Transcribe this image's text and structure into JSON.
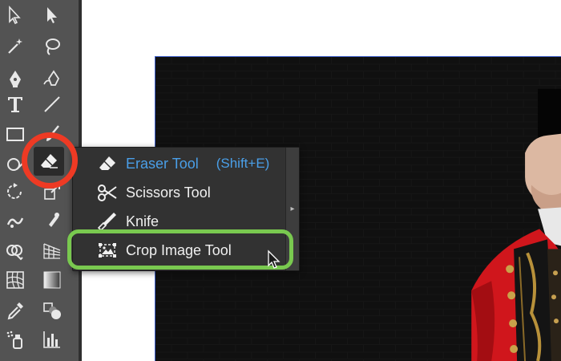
{
  "toolbar": {
    "tools": [
      {
        "name": "direct-selection-tool-icon"
      },
      {
        "name": "selection-tool-icon"
      },
      {
        "name": "magic-wand-tool-icon"
      },
      {
        "name": "lasso-tool-icon"
      },
      {
        "name": "pen-tool-icon"
      },
      {
        "name": "curvature-tool-icon"
      },
      {
        "name": "type-tool-icon",
        "glyph": "T"
      },
      {
        "name": "line-segment-tool-icon"
      },
      {
        "name": "rectangle-tool-icon"
      },
      {
        "name": "paintbrush-tool-icon"
      },
      {
        "name": "shaper-tool-icon"
      },
      {
        "name": "eraser-tool-icon",
        "active": true
      },
      {
        "name": "rotate-tool-icon"
      },
      {
        "name": "scale-tool-icon"
      },
      {
        "name": "warp-tool-icon"
      },
      {
        "name": "puppet-warp-tool-icon"
      },
      {
        "name": "shape-builder-tool-icon"
      },
      {
        "name": "perspective-grid-tool-icon"
      },
      {
        "name": "mesh-tool-icon"
      },
      {
        "name": "gradient-tool-icon"
      },
      {
        "name": "eyedropper-tool-icon"
      },
      {
        "name": "blend-tool-icon"
      },
      {
        "name": "symbol-sprayer-tool-icon"
      },
      {
        "name": "column-graph-tool-icon"
      }
    ]
  },
  "flyout": {
    "items": [
      {
        "label": "Eraser Tool",
        "shortcut": "(Shift+E)",
        "icon": "eraser-icon",
        "selected": true
      },
      {
        "label": "Scissors Tool",
        "icon": "scissors-icon"
      },
      {
        "label": "Knife",
        "icon": "knife-icon"
      },
      {
        "label": "Crop Image Tool",
        "icon": "crop-image-icon"
      }
    ],
    "collapse_glyph": "▸"
  },
  "colors": {
    "toolbar_bg": "#535353",
    "menu_bg": "#323232",
    "selected_text": "#4a9fe8",
    "annotation_red": "#ee3a24",
    "annotation_green": "#79c94f",
    "artboard_bg": "#0e0e0e",
    "coat_red": "#d0161c"
  }
}
